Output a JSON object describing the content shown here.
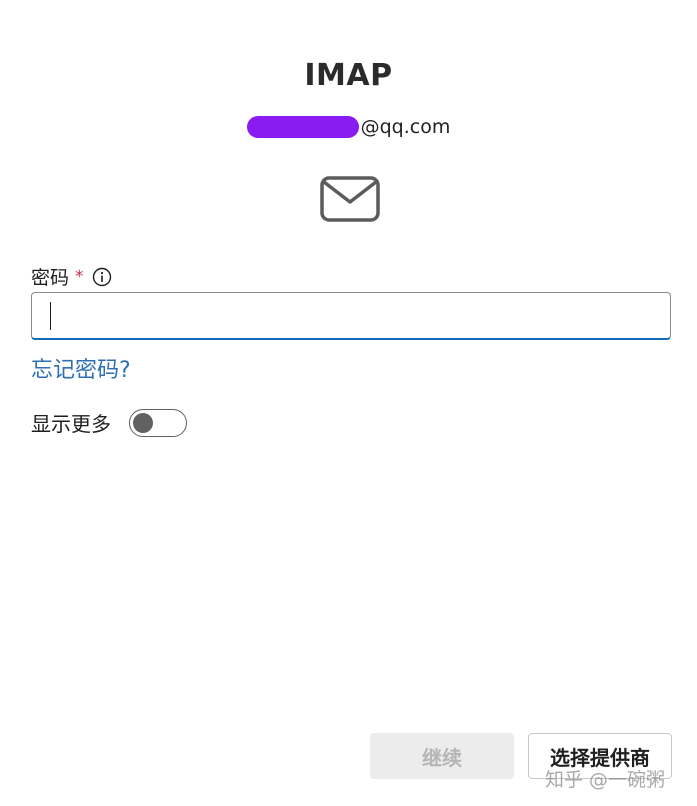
{
  "dialog": {
    "title": "IMAP",
    "email_suffix": "@qq.com"
  },
  "password_field": {
    "label": "密码",
    "required_mark": "*",
    "value": ""
  },
  "links": {
    "forgot_password": "忘记密码?"
  },
  "show_more": {
    "label": "显示更多",
    "enabled": false
  },
  "buttons": {
    "continue_label": "继续",
    "choose_provider_label": "选择提供商"
  },
  "watermark": {
    "text": "知乎 @一碗粥"
  },
  "icons": {
    "mail": "mail-envelope-icon",
    "info": "info-circle-icon"
  },
  "colors": {
    "accent": "#0f6cbd",
    "link": "#2f6fb5",
    "required": "#c4314b",
    "redaction": "#8a1cf2"
  }
}
